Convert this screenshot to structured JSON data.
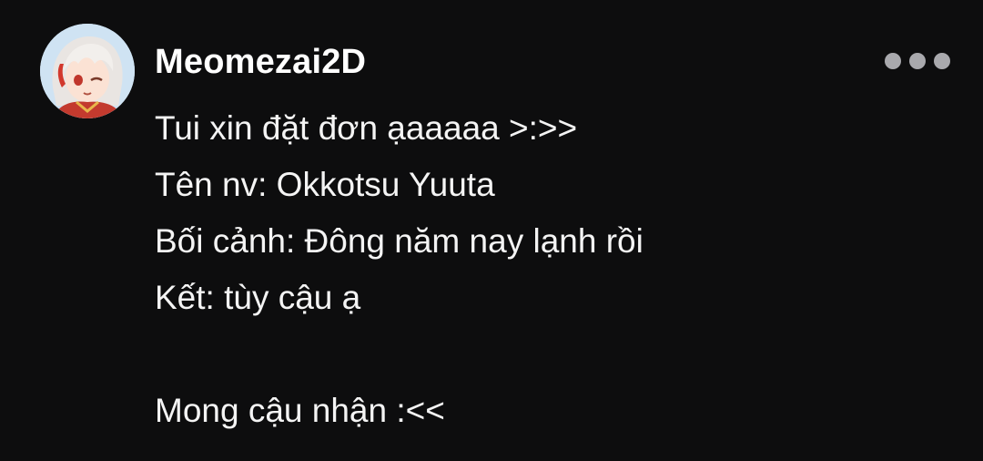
{
  "post": {
    "username": "Meomezai2D",
    "avatar_icon": "avatar-anime-character-icon",
    "more_icon": "more-options-icon",
    "lines": [
      "Tui xin đặt đơn ạaaaaa >:>>",
      "Tên nv: Okkotsu Yuuta",
      "Bối cảnh: Đông năm nay lạnh rồi",
      "Kết: tùy cậu ạ",
      "",
      "Mong cậu nhận :<<"
    ]
  },
  "colors": {
    "background": "#0d0d0e",
    "text": "#f4f4f4",
    "dots": "#a9a9ad"
  }
}
